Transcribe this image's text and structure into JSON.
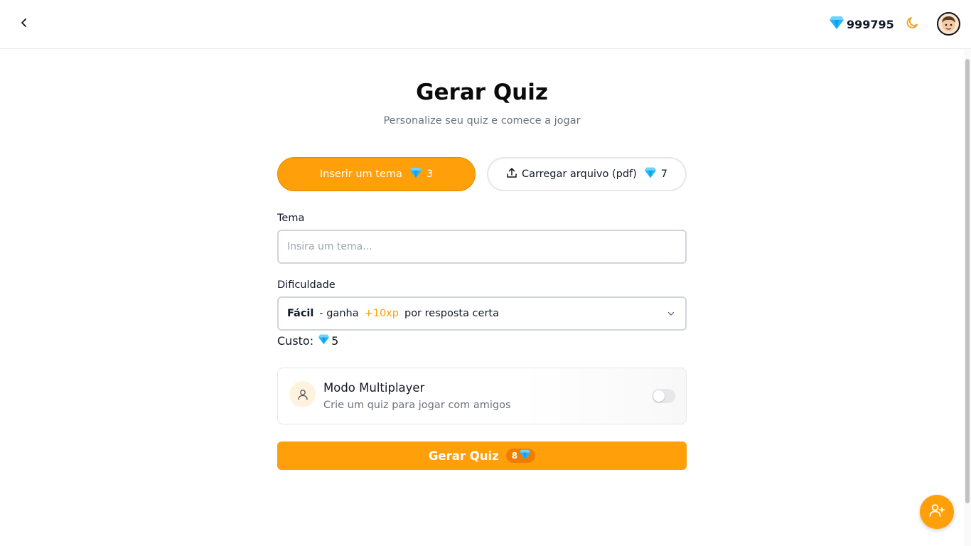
{
  "header": {
    "back_icon": "chevron-left-icon",
    "gem_balance": "999795",
    "theme_icon": "moon-icon",
    "avatar_icon": "avatar"
  },
  "page": {
    "title": "Gerar Quiz",
    "subtitle": "Personalize seu quiz e comece a jogar"
  },
  "tabs": [
    {
      "label": "Inserir um tema",
      "cost": "3",
      "active": true
    },
    {
      "label": "Carregar arquivo (pdf)",
      "cost": "7",
      "active": false,
      "icon": "upload-icon"
    }
  ],
  "form": {
    "topic_label": "Tema",
    "topic_placeholder": "Insira um tema...",
    "topic_value": "",
    "difficulty_label": "Dificuldade",
    "difficulty": {
      "level": "Fácil",
      "mid": "- ganha",
      "xp": "+10xp",
      "suffix": "por resposta certa"
    },
    "cost_label": "Custo:",
    "cost_value": "5"
  },
  "multiplayer": {
    "title": "Modo Multiplayer",
    "description": "Crie um quiz para jogar com amigos",
    "enabled": false,
    "icon": "user-icon"
  },
  "generate": {
    "label": "Gerar Quiz",
    "cost": "8"
  },
  "fab_icon": "add-user-icon",
  "colors": {
    "accent": "#ff9f0a",
    "gem": "#1fb6ff"
  }
}
